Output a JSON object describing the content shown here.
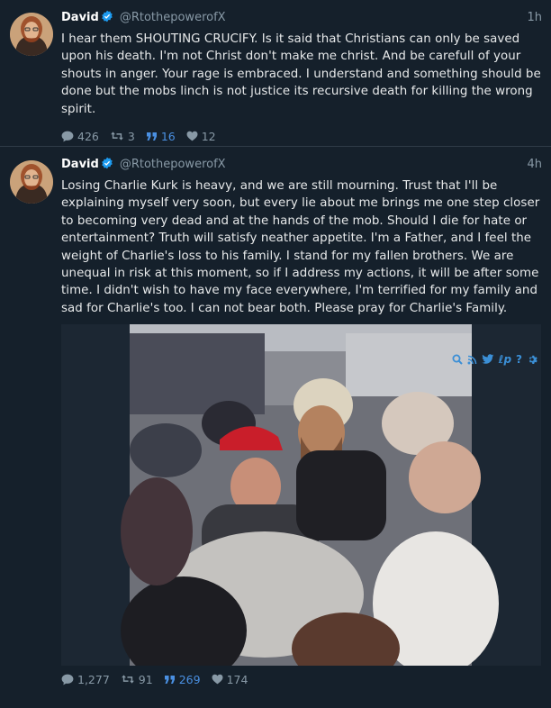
{
  "tweets": [
    {
      "name": "David",
      "handle": "@RtothepowerofX",
      "time": "1h",
      "text": "I hear them SHOUTING CRUCIFY. Is it said that Christians can only be saved upon his death. I'm not Christ don't make me christ. And be carefull of your shouts in anger. Your rage is embraced. I understand and something should be done but the mobs linch is not justice its recursive death for killing the wrong spirit.",
      "replies": "426",
      "retweets": "3",
      "quotes": "16",
      "likes": "12"
    },
    {
      "name": "David",
      "handle": "@RtothepowerofX",
      "time": "4h",
      "text": "Losing Charlie Kurk is heavy, and we are still mourning. Trust that I'll be explaining myself very soon, but every lie about me brings me one step closer to becoming very dead and at the hands of the mob. Should I die for hate or entertainment? Truth will satisfy neather appetite. I'm a Father, and I feel the weight of Charlie's loss to his family. I stand for my fallen brothers. We are unequal in risk at this moment, so if I address my actions, it will be after some time. I didn't wish to have my face everywhere, I'm terrified for my family and sad for Charlie's too. I can not bear both. Please pray for Charlie's Family.",
      "replies": "1,277",
      "retweets": "91",
      "quotes": "269",
      "likes": "174"
    }
  ],
  "colors": {
    "background": "#15202b",
    "muted": "#8899a6",
    "accent": "#1d9bf0",
    "quote_accent": "#4a90e2"
  },
  "icons": [
    "verified-icon",
    "reply-icon",
    "retweet-icon",
    "quote-icon",
    "like-icon",
    "search-icon",
    "rss-icon",
    "twitter-icon",
    "lp-icon",
    "help-icon",
    "settings-icon"
  ]
}
